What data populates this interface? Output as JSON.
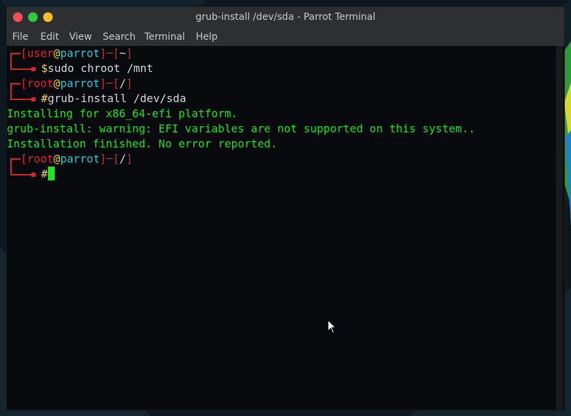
{
  "window": {
    "title": "grub-install /dev/sda - Parrot Terminal"
  },
  "menu": [
    "File",
    "Edit",
    "View",
    "Search",
    "Terminal",
    "Help"
  ],
  "terminal": {
    "prompt1": {
      "user": "user",
      "at": "@",
      "host": "parrot",
      "dir": "~",
      "symbol": "$",
      "command": "sudo chroot /mnt"
    },
    "prompt2": {
      "user": "root",
      "at": "@",
      "host": "parrot",
      "dir": "/",
      "symbol": "#",
      "command": "grub-install /dev/sda"
    },
    "output": [
      "Installing for x86_64-efi platform.",
      "grub-install: warning: EFI variables are not supported on this system..",
      "Installation finished. No error reported."
    ],
    "prompt3": {
      "user": "root",
      "at": "@",
      "host": "parrot",
      "dir": "/",
      "symbol": "#",
      "command": ""
    }
  },
  "colors": {
    "prompt_frame": "#d7262c",
    "host": "#27c7d8",
    "symbol": "#ecd54c",
    "output": "#1de024",
    "titlebar": "#2d2f31"
  }
}
